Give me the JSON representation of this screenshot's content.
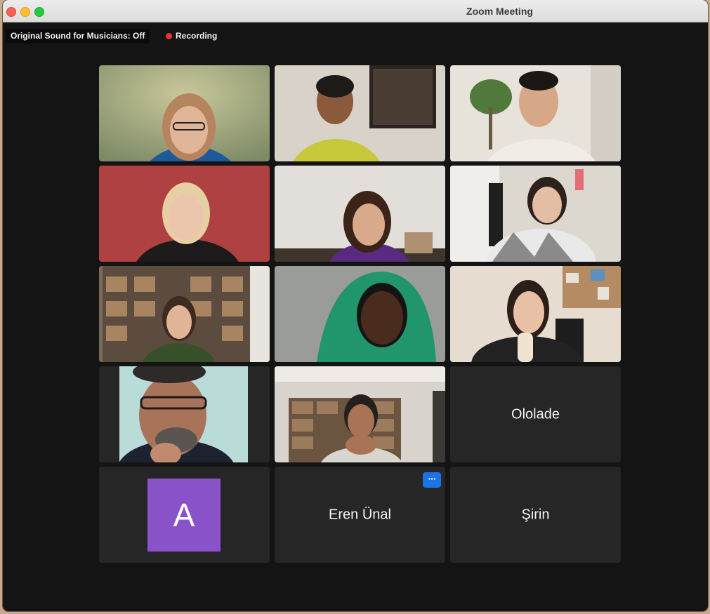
{
  "window": {
    "title": "Zoom Meeting"
  },
  "status": {
    "sound_label": "Original Sound for Musicians: Off",
    "recording_label": "Recording",
    "recording_color": "#e8362f"
  },
  "participants": [
    {
      "type": "video",
      "icon": "participant-video"
    },
    {
      "type": "video",
      "icon": "participant-video"
    },
    {
      "type": "video",
      "icon": "participant-video"
    },
    {
      "type": "video",
      "icon": "participant-video"
    },
    {
      "type": "video",
      "icon": "participant-video"
    },
    {
      "type": "video",
      "icon": "participant-video",
      "speaking": true
    },
    {
      "type": "video",
      "icon": "participant-video"
    },
    {
      "type": "video",
      "icon": "participant-video"
    },
    {
      "type": "video",
      "icon": "participant-video"
    },
    {
      "type": "video",
      "icon": "participant-video"
    },
    {
      "type": "video",
      "icon": "participant-video"
    },
    {
      "type": "name",
      "name": "Ololade"
    },
    {
      "type": "avatar",
      "initial": "A",
      "avatar_color": "#8a52c9"
    },
    {
      "type": "name",
      "name": "Eren Ünal",
      "more_label": "···"
    },
    {
      "type": "name",
      "name": "Şirin"
    }
  ],
  "colors": {
    "speaking_border": "#35d04b",
    "more_button": "#1a74e8",
    "tile_background": "#262626"
  }
}
